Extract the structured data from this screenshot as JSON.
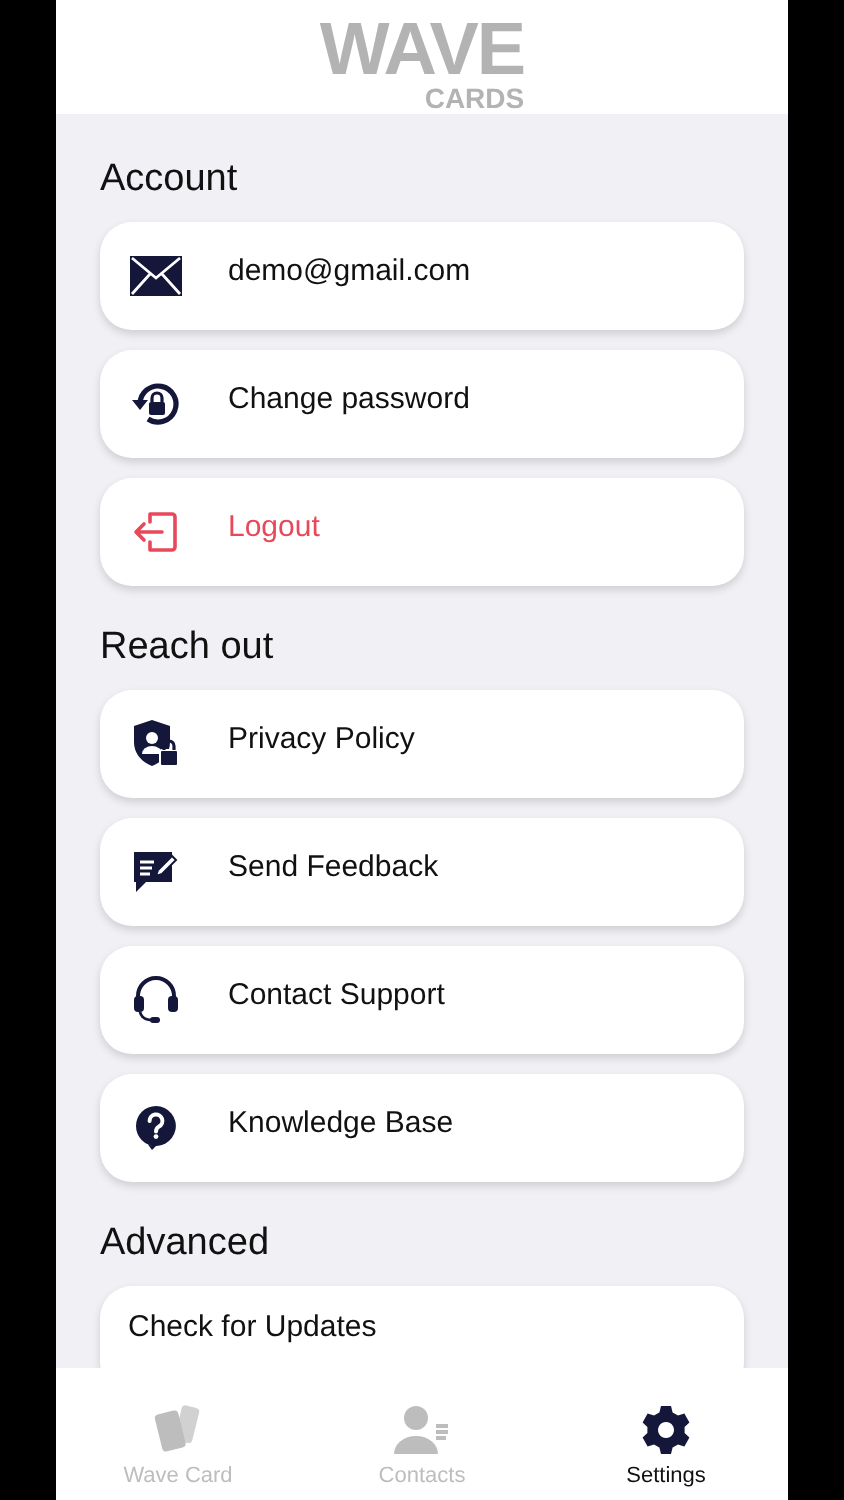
{
  "logo": {
    "title": "WAVE",
    "subtitle": "CARDS"
  },
  "sections": [
    {
      "title": "Account",
      "items": [
        {
          "kind": "email",
          "label": "demo@gmail.com"
        },
        {
          "kind": "password",
          "label": "Change password"
        },
        {
          "kind": "logout",
          "label": "Logout"
        }
      ]
    },
    {
      "title": "Reach out",
      "items": [
        {
          "kind": "privacy",
          "label": "Privacy Policy"
        },
        {
          "kind": "feedback",
          "label": "Send Feedback"
        },
        {
          "kind": "support",
          "label": "Contact Support"
        },
        {
          "kind": "help",
          "label": "Knowledge Base"
        }
      ]
    },
    {
      "title": "Advanced",
      "items": [
        {
          "kind": "plain",
          "label": "Check for Updates"
        }
      ]
    }
  ],
  "tabs": [
    {
      "kind": "card",
      "label": "Wave Card",
      "selected": false
    },
    {
      "kind": "contacts",
      "label": "Contacts",
      "selected": false
    },
    {
      "kind": "settings",
      "label": "Settings",
      "selected": true
    }
  ]
}
